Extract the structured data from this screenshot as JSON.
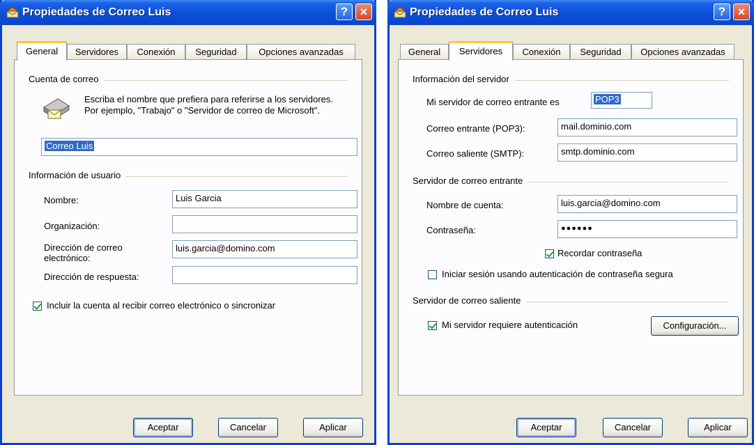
{
  "dialog1": {
    "title": "Propiedades de Correo Luis",
    "help": "?",
    "close": "×",
    "tabs": [
      "General",
      "Servidores",
      "Conexión",
      "Seguridad",
      "Opciones avanzadas"
    ],
    "active_tab": "General",
    "mail_account": {
      "group": "Cuenta de correo",
      "description": "Escriba el nombre que prefiera para referirse a los servidores. Por ejemplo, \"Trabajo\" o \"Servidor de correo de Microsoft\".",
      "account_name": "Correo Luis"
    },
    "user_info": {
      "group": "Información de usuario",
      "name_label": "Nombre:",
      "name_value": "Luis Garcia",
      "org_label": "Organización:",
      "org_value": "",
      "email_label": "Dirección de correo electrónico:",
      "email_value": "luis.garcia@domino.com",
      "reply_label": "Dirección de respuesta:",
      "reply_value": ""
    },
    "include_label": "Incluir la cuenta al recibir correo electrónico o sincronizar",
    "include_checked": true,
    "buttons": {
      "accept": "Aceptar",
      "cancel": "Cancelar",
      "apply": "Aplicar"
    }
  },
  "dialog2": {
    "title": "Propiedades de Correo Luis",
    "help": "?",
    "close": "×",
    "tabs": [
      "General",
      "Servidores",
      "Conexión",
      "Seguridad",
      "Opciones avanzadas"
    ],
    "active_tab": "Servidores",
    "server_info": {
      "group": "Información del servidor",
      "incoming_type_label": "Mi servidor de correo entrante es",
      "incoming_type_value": "POP3",
      "incoming_label": "Correo entrante (POP3):",
      "incoming_value": "mail.dominio.com",
      "outgoing_label": "Correo saliente (SMTP):",
      "outgoing_value": "smtp.dominio.com"
    },
    "incoming_server": {
      "group": "Servidor de correo entrante",
      "account_label": "Nombre de cuenta:",
      "account_value": "luis.garcia@domino.com",
      "password_label": "Contraseña:",
      "password_value": "●●●●●●",
      "remember_label": "Recordar contraseña",
      "remember_checked": true,
      "spa_label": "Iniciar sesión usando autenticación de contraseña segura",
      "spa_checked": false
    },
    "outgoing_server": {
      "group": "Servidor de correo saliente",
      "auth_label": "Mi servidor requiere autenticación",
      "auth_checked": true,
      "settings_button": "Configuración..."
    },
    "buttons": {
      "accept": "Aceptar",
      "cancel": "Cancelar",
      "apply": "Aplicar"
    }
  }
}
